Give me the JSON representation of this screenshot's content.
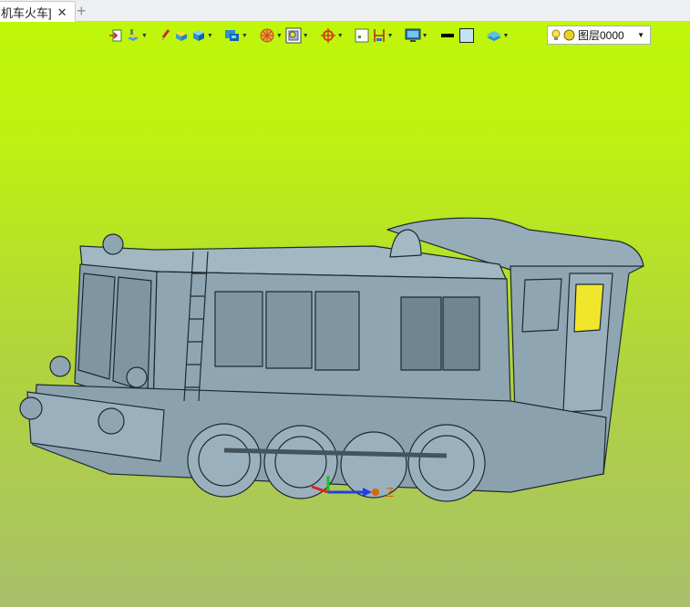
{
  "tabs": [
    {
      "label": "机车火车]",
      "active": true
    }
  ],
  "tab_close_glyph": "✕",
  "tab_add_glyph": "+",
  "toolbar": {
    "buttons": [
      {
        "name": "import-icon",
        "dropdown": false
      },
      {
        "name": "paint-layers-icon",
        "dropdown": true
      },
      {
        "name": "brush-icon",
        "dropdown": false
      },
      {
        "name": "face-color-icon",
        "dropdown": false
      },
      {
        "name": "solid-box-icon",
        "dropdown": true
      },
      {
        "name": "display-mode-icon",
        "dropdown": true
      },
      {
        "name": "view-orient-icon",
        "dropdown": true
      },
      {
        "name": "zoom-fit-icon",
        "dropdown": true
      },
      {
        "name": "crosshair-icon",
        "dropdown": true
      },
      {
        "name": "grid-point-icon",
        "dropdown": false
      },
      {
        "name": "dimension-icon",
        "dropdown": true
      },
      {
        "name": "monitor-icon",
        "dropdown": true
      },
      {
        "name": "line-style-icon",
        "dropdown": false
      },
      {
        "name": "fill-color-icon",
        "dropdown": false
      },
      {
        "name": "layers-icon",
        "dropdown": true
      }
    ]
  },
  "layer": {
    "value": "图层0000",
    "colors": {
      "bulb": "#ffe14d",
      "dot": "#e8d22a"
    }
  },
  "axis": {
    "z_label": "Z"
  },
  "colors": {
    "viewport_top": "#bff60a",
    "viewport_bottom": "#a9c06a",
    "model_fill": "#8fa6b2",
    "model_stroke": "#1e2a30"
  }
}
